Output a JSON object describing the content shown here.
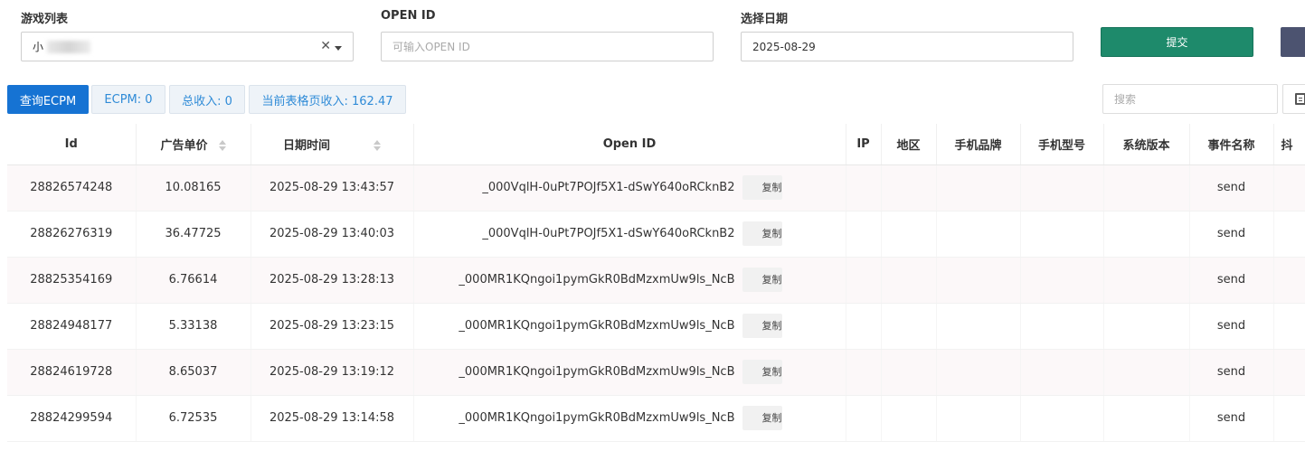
{
  "filters": {
    "game_list_label": "游戏列表",
    "game_list_value": "小",
    "open_id_label": "OPEN ID",
    "open_id_placeholder": "可输入OPEN ID",
    "date_label": "选择日期",
    "date_value": "2025-08-29",
    "submit_label": "提交"
  },
  "toolbar": {
    "query_ecpm": "查询ECPM",
    "ecpm": "ECPM: 0",
    "total_income": "总收入: 0",
    "page_income": "当前表格页收入: 162.47",
    "search_placeholder": "搜索"
  },
  "table": {
    "headers": [
      "Id",
      "广告单价",
      "日期时间",
      "Open ID",
      "IP",
      "地区",
      "手机品牌",
      "手机型号",
      "系统版本",
      "事件名称",
      "抖"
    ],
    "copy_label": "复制",
    "rows": [
      {
        "id": "28826574248",
        "price": "10.08165",
        "datetime": "2025-08-29 13:43:57",
        "open_id": "_000VqlH-0uPt7POJf5X1-dSwY640oRCknB2",
        "ip": "",
        "region": "",
        "brand": "",
        "model": "",
        "os": "",
        "event": "send"
      },
      {
        "id": "28826276319",
        "price": "36.47725",
        "datetime": "2025-08-29 13:40:03",
        "open_id": "_000VqlH-0uPt7POJf5X1-dSwY640oRCknB2",
        "ip": "",
        "region": "",
        "brand": "",
        "model": "",
        "os": "",
        "event": "send"
      },
      {
        "id": "28825354169",
        "price": "6.76614",
        "datetime": "2025-08-29 13:28:13",
        "open_id": "_000MR1KQngoi1pymGkR0BdMzxmUw9ls_NcB",
        "ip": "",
        "region": "",
        "brand": "",
        "model": "",
        "os": "",
        "event": "send"
      },
      {
        "id": "28824948177",
        "price": "5.33138",
        "datetime": "2025-08-29 13:23:15",
        "open_id": "_000MR1KQngoi1pymGkR0BdMzxmUw9ls_NcB",
        "ip": "",
        "region": "",
        "brand": "",
        "model": "",
        "os": "",
        "event": "send"
      },
      {
        "id": "28824619728",
        "price": "8.65037",
        "datetime": "2025-08-29 13:19:12",
        "open_id": "_000MR1KQngoi1pymGkR0BdMzxmUw9ls_NcB",
        "ip": "",
        "region": "",
        "brand": "",
        "model": "",
        "os": "",
        "event": "send"
      },
      {
        "id": "28824299594",
        "price": "6.72535",
        "datetime": "2025-08-29 13:14:58",
        "open_id": "_000MR1KQngoi1pymGkR0BdMzxmUw9ls_NcB",
        "ip": "",
        "region": "",
        "brand": "",
        "model": "",
        "os": "",
        "event": "send"
      }
    ]
  },
  "colors": {
    "submit": "#1e8a6b",
    "primary": "#1673d3",
    "info_text": "#2f8bd7"
  }
}
